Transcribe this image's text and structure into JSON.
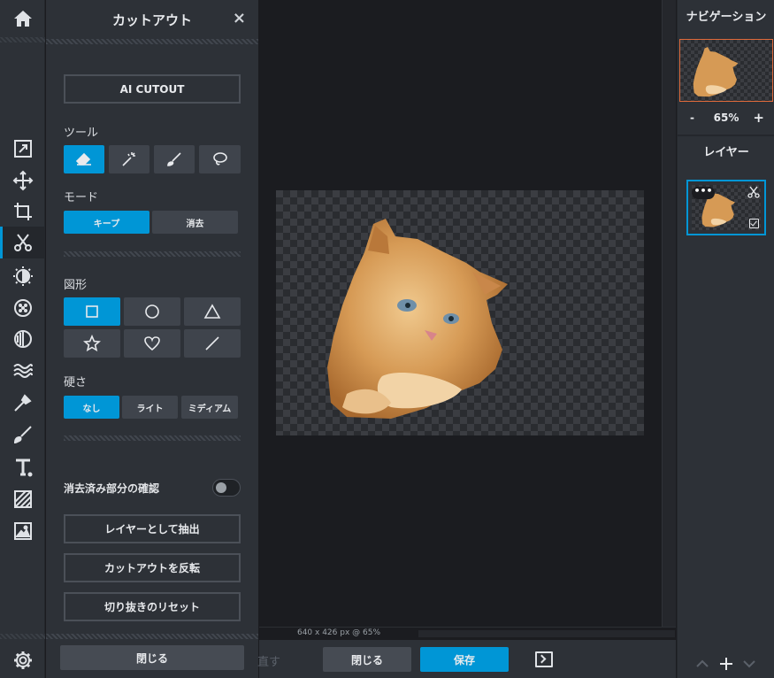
{
  "panel": {
    "title": "カットアウト",
    "close_glyph": "×",
    "ai_cutout_label": "AI CUTOUT",
    "tools_label": "ツール",
    "tools": [
      {
        "icon": "eraser-icon",
        "active": true
      },
      {
        "icon": "magic-wand-icon",
        "active": false
      },
      {
        "icon": "brush-icon",
        "active": false
      },
      {
        "icon": "lasso-icon",
        "active": false
      }
    ],
    "mode_label": "モード",
    "modes": [
      "キープ",
      "消去"
    ],
    "mode_selected": "キープ",
    "shape_label": "図形",
    "shapes": [
      "square-icon",
      "circle-icon",
      "triangle-icon",
      "star-icon",
      "heart-icon",
      "line-icon"
    ],
    "shape_selected": "square-icon",
    "hardness_label": "硬さ",
    "hardness": [
      "なし",
      "ライト",
      "ミディアム"
    ],
    "hardness_selected": "なし",
    "erased_check_label": "消去済み部分の確認",
    "erased_check_on": false,
    "extract_layer_label": "レイヤーとして抽出",
    "invert_label": "カットアウトを反転",
    "reset_label": "切り抜きのリセット",
    "close_label": "閉じる"
  },
  "canvas": {
    "dimensions_text": "640 x 426 px @ 65%"
  },
  "bottombar": {
    "redo_label": "直す",
    "close_label": "閉じる",
    "save_label": "保存"
  },
  "navigator": {
    "title": "ナビゲーション",
    "zoom_minus": "-",
    "zoom_value": "65%",
    "zoom_plus": "+"
  },
  "layers": {
    "title": "レイヤー",
    "menu_dots": "•••"
  },
  "colors": {
    "accent": "#0096d6",
    "panel_bg": "#2d3137",
    "canvas_bg": "#1b1c20",
    "nav_highlight": "#e06a3b"
  }
}
